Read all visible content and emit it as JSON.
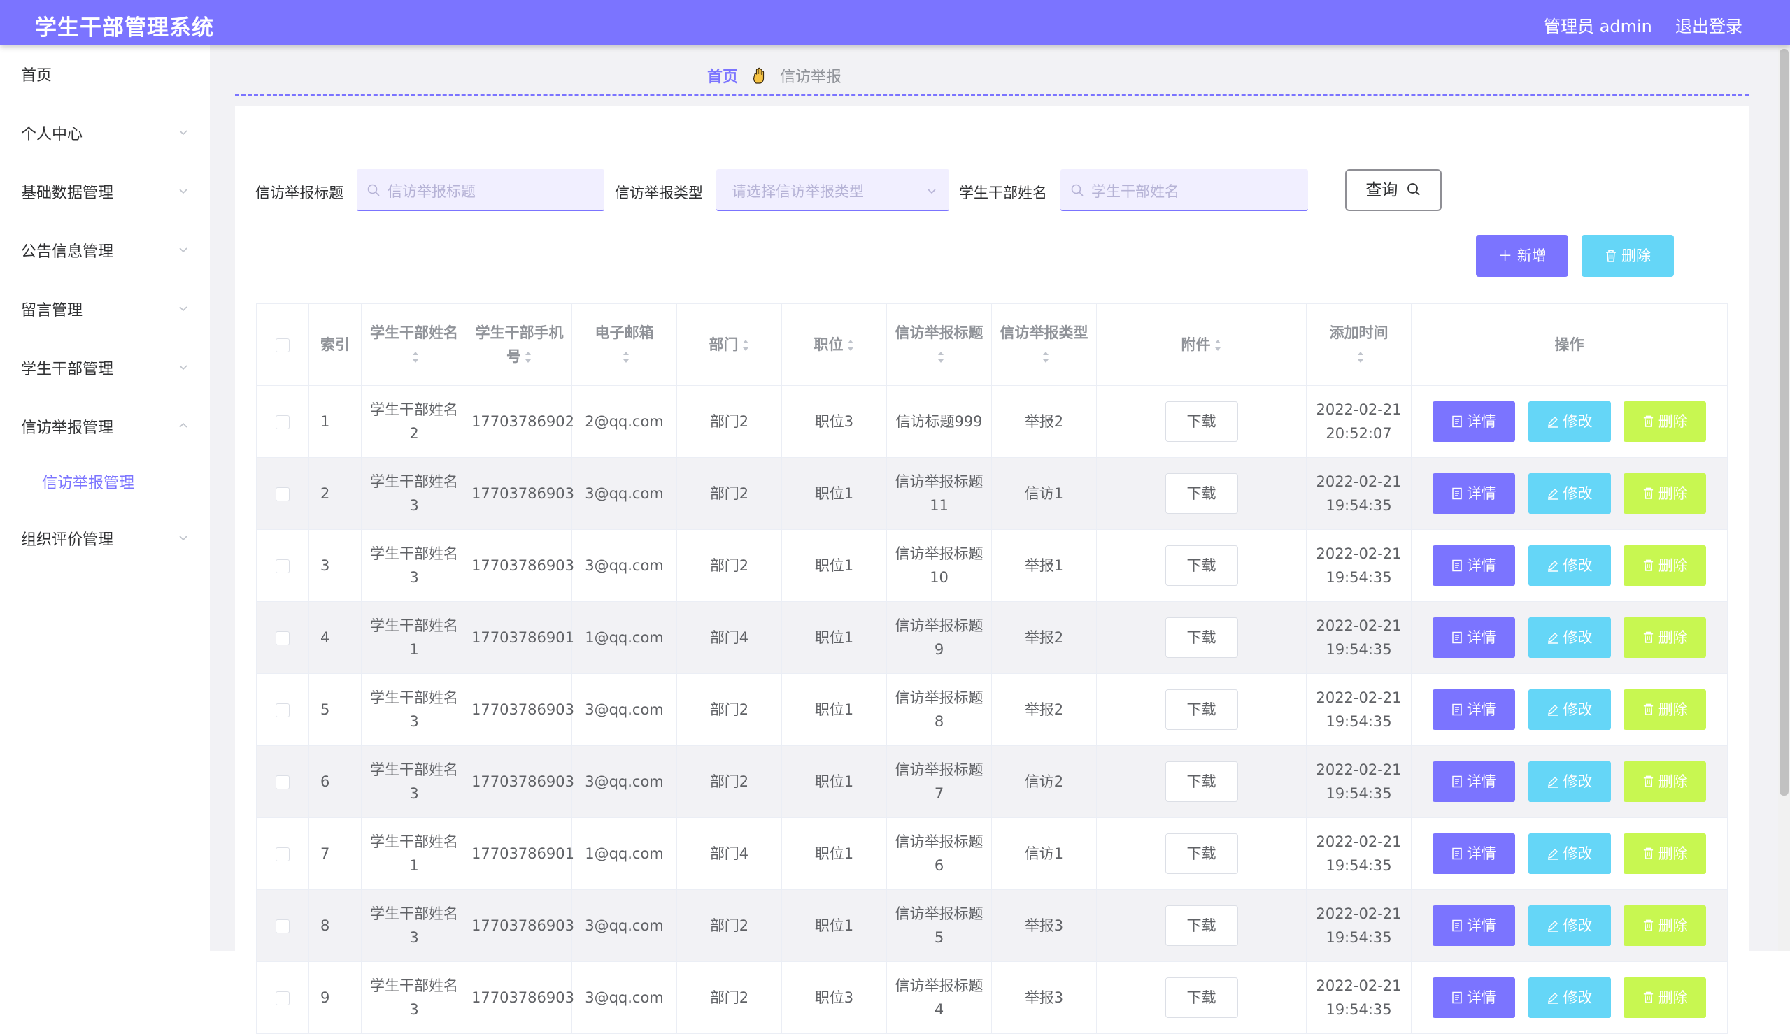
{
  "header": {
    "title": "学生干部管理系统",
    "user": "管理员 admin",
    "logout": "退出登录"
  },
  "sidebar": {
    "items": [
      {
        "label": "首页",
        "has_children": false
      },
      {
        "label": "个人中心",
        "has_children": true
      },
      {
        "label": "基础数据管理",
        "has_children": true
      },
      {
        "label": "公告信息管理",
        "has_children": true
      },
      {
        "label": "留言管理",
        "has_children": true
      },
      {
        "label": "学生干部管理",
        "has_children": true
      },
      {
        "label": "信访举报管理",
        "has_children": true,
        "expanded": true
      },
      {
        "label": "组织评价管理",
        "has_children": true
      }
    ],
    "sub_item": "信访举报管理"
  },
  "breadcrumb": {
    "home": "首页",
    "current": "信访举报"
  },
  "filters": {
    "title_label": "信访举报标题",
    "title_placeholder": "信访举报标题",
    "type_label": "信访举报类型",
    "type_placeholder": "请选择信访举报类型",
    "name_label": "学生干部姓名",
    "name_placeholder": "学生干部姓名",
    "query_button": "查询"
  },
  "actions": {
    "add": "新增",
    "delete": "删除"
  },
  "table": {
    "headers": [
      "索引",
      "学生干部姓名",
      "学生干部手机号",
      "电子邮箱",
      "部门",
      "职位",
      "信访举报标题",
      "信访举报类型",
      "附件",
      "添加时间",
      "操作"
    ],
    "download_label": "下载",
    "op_labels": {
      "detail": "详情",
      "edit": "修改",
      "delete": "删除"
    },
    "rows": [
      {
        "index": "1",
        "name": "学生干部姓名2",
        "phone": "17703786902",
        "email": "2@qq.com",
        "dept": "部门2",
        "position": "职位3",
        "title": "信访标题999",
        "type": "举报2",
        "time": "2022-02-21 20:52:07"
      },
      {
        "index": "2",
        "name": "学生干部姓名3",
        "phone": "17703786903",
        "email": "3@qq.com",
        "dept": "部门2",
        "position": "职位1",
        "title": "信访举报标题11",
        "type": "信访1",
        "time": "2022-02-21 19:54:35"
      },
      {
        "index": "3",
        "name": "学生干部姓名3",
        "phone": "17703786903",
        "email": "3@qq.com",
        "dept": "部门2",
        "position": "职位1",
        "title": "信访举报标题10",
        "type": "举报1",
        "time": "2022-02-21 19:54:35"
      },
      {
        "index": "4",
        "name": "学生干部姓名1",
        "phone": "17703786901",
        "email": "1@qq.com",
        "dept": "部门4",
        "position": "职位1",
        "title": "信访举报标题9",
        "type": "举报2",
        "time": "2022-02-21 19:54:35"
      },
      {
        "index": "5",
        "name": "学生干部姓名3",
        "phone": "17703786903",
        "email": "3@qq.com",
        "dept": "部门2",
        "position": "职位1",
        "title": "信访举报标题8",
        "type": "举报2",
        "time": "2022-02-21 19:54:35"
      },
      {
        "index": "6",
        "name": "学生干部姓名3",
        "phone": "17703786903",
        "email": "3@qq.com",
        "dept": "部门2",
        "position": "职位1",
        "title": "信访举报标题7",
        "type": "信访2",
        "time": "2022-02-21 19:54:35"
      },
      {
        "index": "7",
        "name": "学生干部姓名1",
        "phone": "17703786901",
        "email": "1@qq.com",
        "dept": "部门4",
        "position": "职位1",
        "title": "信访举报标题6",
        "type": "信访1",
        "time": "2022-02-21 19:54:35"
      },
      {
        "index": "8",
        "name": "学生干部姓名3",
        "phone": "17703786903",
        "email": "3@qq.com",
        "dept": "部门2",
        "position": "职位1",
        "title": "信访举报标题5",
        "type": "举报3",
        "time": "2022-02-21 19:54:35"
      },
      {
        "index": "9",
        "name": "学生干部姓名3",
        "phone": "17703786903",
        "email": "3@qq.com",
        "dept": "部门2",
        "position": "职位3",
        "title": "信访举报标题4",
        "type": "举报3",
        "time": "2022-02-21 19:54:35"
      }
    ]
  },
  "colors": {
    "primary": "#7b74ff",
    "info": "#65d6f7",
    "lime": "#c8f751",
    "background": "#f2f2f5"
  }
}
